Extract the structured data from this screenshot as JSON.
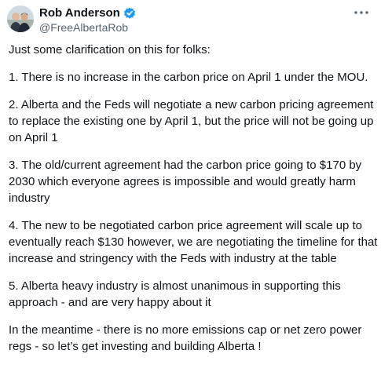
{
  "tweet": {
    "author": {
      "display_name": "Rob Anderson",
      "handle": "@FreeAlbertaRob",
      "verified": true,
      "verified_color": "#1d9bf0"
    },
    "more_icon": "more-horizontal-icon",
    "paragraphs": [
      "Just some clarification on this for folks:",
      "1. There is no increase in the carbon price on April 1 under the MOU.",
      "2. Alberta and the Feds will negotiate a new carbon pricing agreement to replace the existing one by April 1, but the price will not be going up on April 1",
      "3. The old/current agreement had the carbon price going to $170 by 2030 which everyone agrees is impossible and would greatly harm industry",
      "4. The new to be negotiated carbon price agreement will scale up to eventually reach $130 however, we are negotiating the timeline for that increase and stringency with the Feds with industry at the table",
      "5. Alberta heavy industry is almost unanimous in supporting this approach - and are very happy about it",
      "In the meantime - there is no more emissions cap or net zero power regs - so let’s get investing and building Alberta !"
    ]
  }
}
